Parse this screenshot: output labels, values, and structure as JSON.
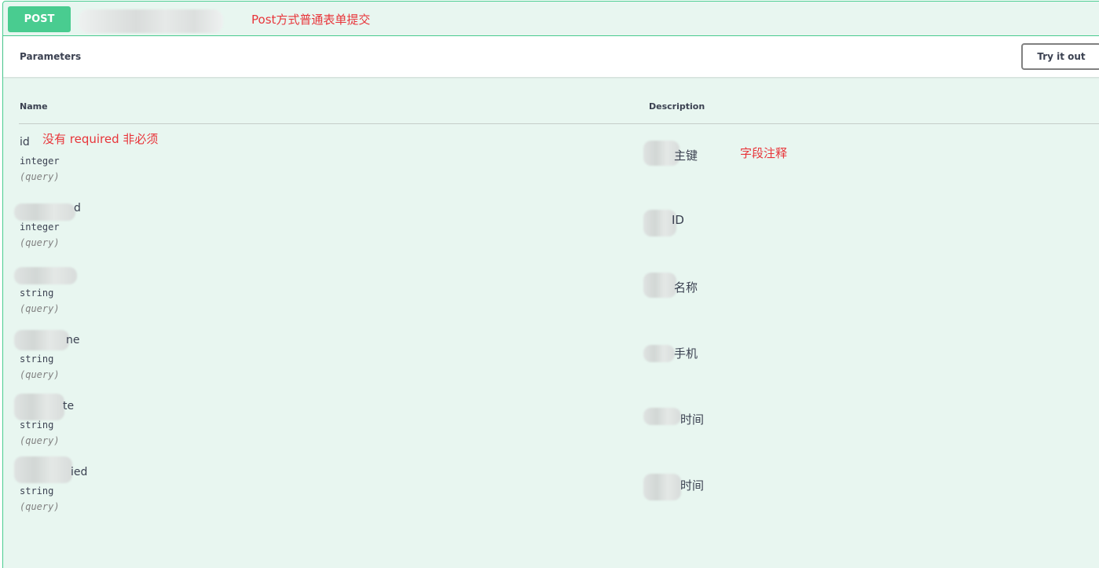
{
  "operation": {
    "method": "POST",
    "annotation_summary": "Post方式普通表单提交"
  },
  "parameters": {
    "title": "Parameters",
    "try_button": "Try it out",
    "col_name": "Name",
    "col_description": "Description",
    "annotation_required": "没有 required 非必须",
    "annotation_description": "字段注释",
    "rows": [
      {
        "name": "id",
        "type": "integer",
        "in": "(query)",
        "description": "主键"
      },
      {
        "name": "d",
        "type": "integer",
        "in": "(query)",
        "description": "ID"
      },
      {
        "name": "",
        "type": "string",
        "in": "(query)",
        "description": "名称"
      },
      {
        "name": "ne",
        "type": "string",
        "in": "(query)",
        "description": "手机"
      },
      {
        "name": "te",
        "type": "string",
        "in": "(query)",
        "description": "时间"
      },
      {
        "name": "ied",
        "type": "string",
        "in": "(query)",
        "description": "时间"
      }
    ]
  },
  "colors": {
    "method_post": "#49cc90",
    "block_bg": "#e8f6f0",
    "annotation": "#e8353a"
  }
}
